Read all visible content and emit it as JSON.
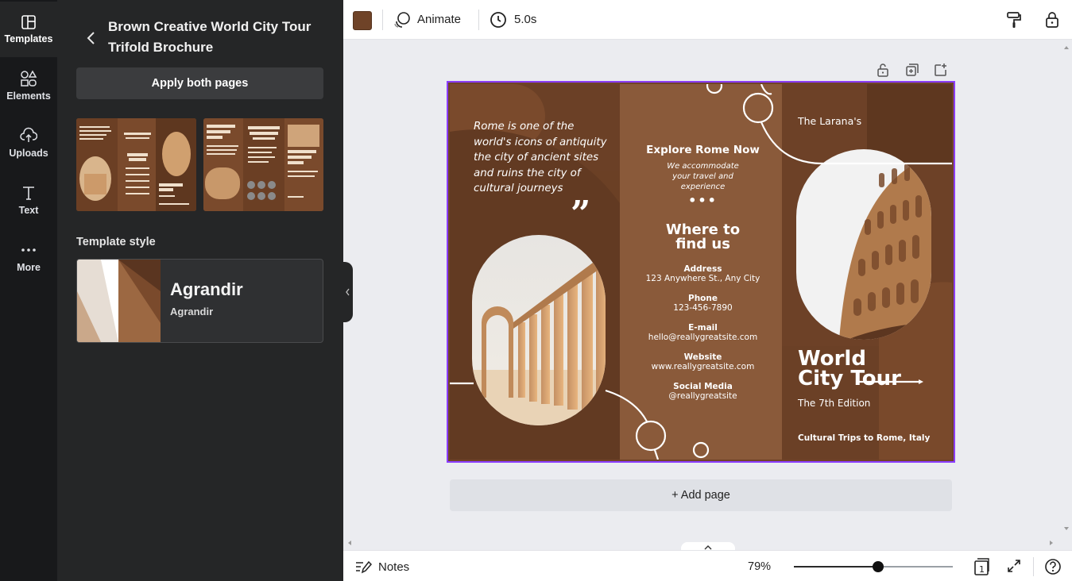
{
  "rail": {
    "items": [
      {
        "label": "Templates",
        "icon": "templates-icon"
      },
      {
        "label": "Elements",
        "icon": "elements-icon"
      },
      {
        "label": "Uploads",
        "icon": "uploads-icon"
      },
      {
        "label": "Text",
        "icon": "text-icon"
      },
      {
        "label": "More",
        "icon": "more-icon"
      }
    ]
  },
  "panel": {
    "title": "Brown Creative World City Tour Trifold Brochure",
    "apply_label": "Apply both pages",
    "section_label": "Template style",
    "style_name": "Agrandir",
    "style_sub": "Agrandir"
  },
  "toolbar": {
    "animate_label": "Animate",
    "duration": "5.0s",
    "fill_color": "#6f4328"
  },
  "design": {
    "quote": "Rome is one of the world's icons of antiquity the city of ancient sites and ruins the city of cultural journeys",
    "explore": "Explore Rome Now",
    "accommodate": "We accommodate your travel and experience",
    "dots": "•••",
    "where": "Where to find us",
    "contacts": [
      {
        "label": "Address",
        "value": "123 Anywhere St., Any City"
      },
      {
        "label": "Phone",
        "value": "123-456-7890"
      },
      {
        "label": "E-mail",
        "value": "hello@reallygreatsite.com"
      },
      {
        "label": "Website",
        "value": "www.reallygreatsite.com"
      },
      {
        "label": "Social Media",
        "value": "@reallygreatsite"
      }
    ],
    "brand": "The Larana's",
    "headline": "World City Tour",
    "edition": "The 7th Edition",
    "tagline": "Cultural Trips to Rome, Italy"
  },
  "canvas": {
    "add_page_label": "+ Add page"
  },
  "bottombar": {
    "notes_label": "Notes",
    "zoom": "79%",
    "zoom_fraction": 0.53,
    "page_count": "1"
  },
  "colors": {
    "accent": "#8b3dff",
    "brown_dark": "#5a3520",
    "brown": "#6f4328",
    "brown_light": "#8a5a3a"
  }
}
